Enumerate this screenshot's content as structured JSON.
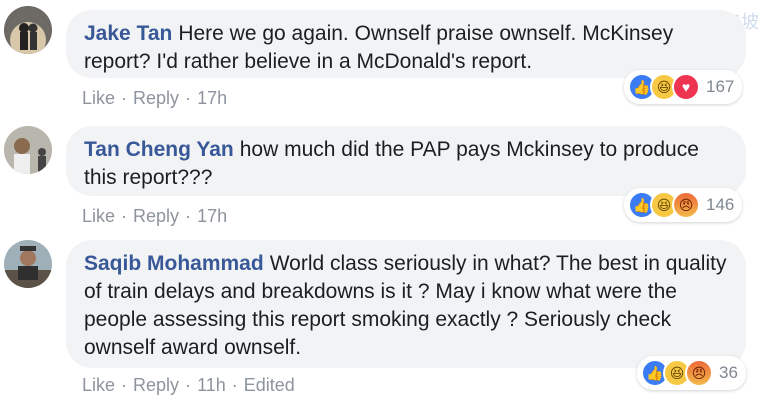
{
  "watermark": "新加坡",
  "comments": [
    {
      "author": "Jake Tan",
      "text": "Here we go again. Ownself praise ownself. McKinsey report? I'd rather believe in a McDonald's report.",
      "actions": {
        "like": "Like",
        "reply": "Reply",
        "time": "17h"
      },
      "reactions": {
        "icons": [
          "like-icon",
          "haha-icon",
          "love-icon"
        ],
        "count": "167"
      }
    },
    {
      "author": "Tan Cheng Yan",
      "text": "how much did the PAP pays Mckinsey to produce this report???",
      "actions": {
        "like": "Like",
        "reply": "Reply",
        "time": "17h"
      },
      "reactions": {
        "icons": [
          "like-icon",
          "haha-icon",
          "angry-icon"
        ],
        "count": "146"
      }
    },
    {
      "author": "Saqib Mohammad",
      "text": "World class seriously in what? The best in quality of train delays and breakdowns is it ? May i know what were the people assessing this report smoking exactly ? Seriously check ownself award ownself.",
      "actions": {
        "like": "Like",
        "reply": "Reply",
        "time": "11h",
        "edited": "Edited"
      },
      "reactions": {
        "icons": [
          "like-icon",
          "haha-icon",
          "angry-icon"
        ],
        "count": "36"
      }
    }
  ],
  "separator": "·"
}
